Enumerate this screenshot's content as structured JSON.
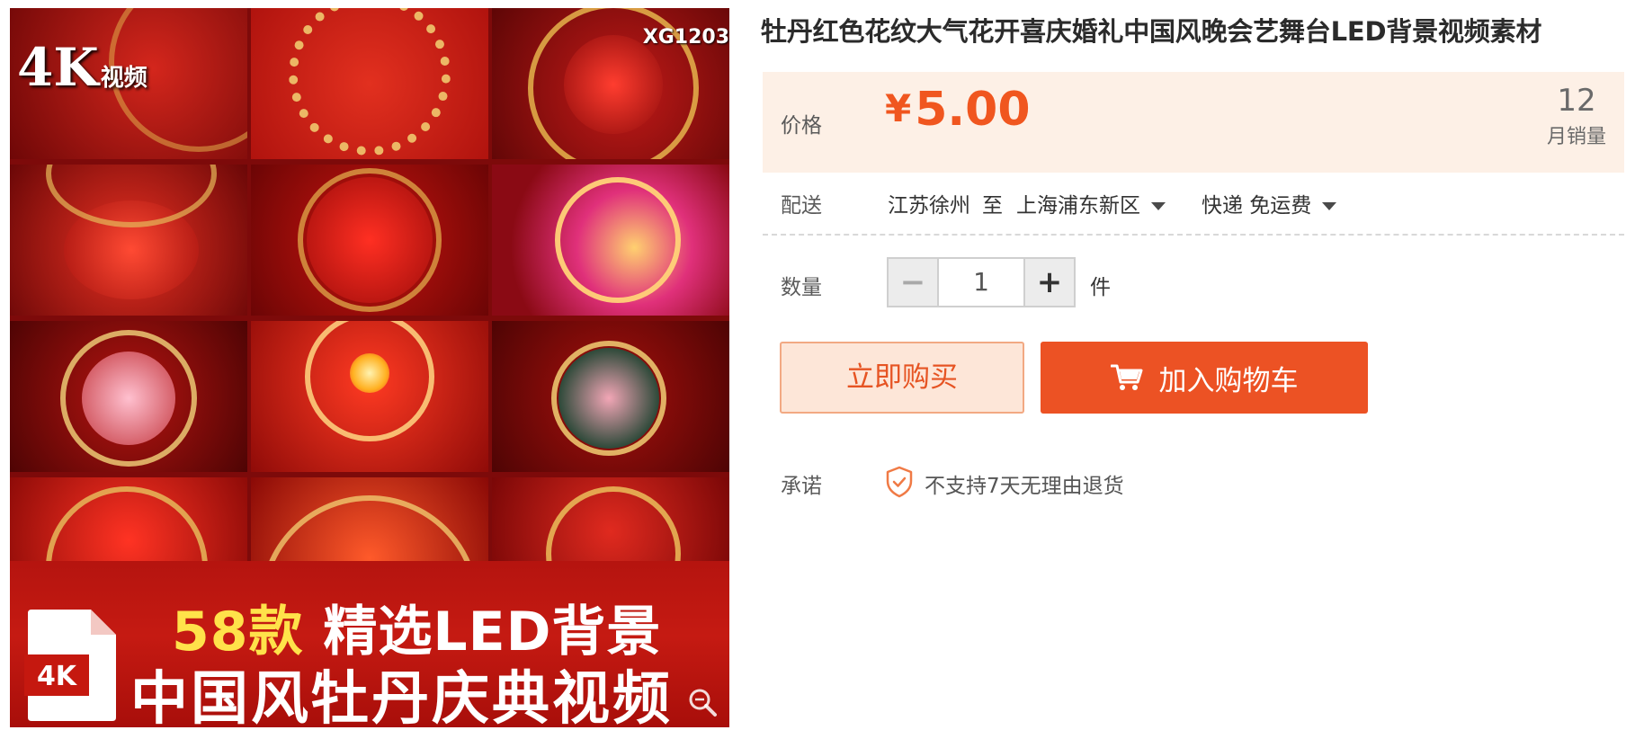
{
  "product_image": {
    "badge_big": "4K",
    "badge_small": "视频",
    "code": "XG1203",
    "banner_count": "58款",
    "banner_line1_rest": "精选LED背景",
    "banner_line2": "中国风牡丹庆典视频",
    "file_icon_label": "4K"
  },
  "title": "牡丹红色花纹大气花开喜庆婚礼中国风晚会艺舞台LED背景视频素材",
  "price": {
    "label": "价格",
    "currency": "¥",
    "value": "5.00",
    "sales_count": "12",
    "sales_label": "月销量"
  },
  "shipping": {
    "label": "配送",
    "from": "江苏徐州",
    "to_word": "至",
    "destination": "上海浦东新区",
    "method": "快递 免运费"
  },
  "quantity": {
    "label": "数量",
    "value": "1",
    "unit": "件",
    "minus": "−",
    "plus": "+"
  },
  "actions": {
    "buy_now": "立即购买",
    "add_to_cart": "加入购物车"
  },
  "promise": {
    "label": "承诺",
    "text": "不支持7天无理由退货"
  },
  "colors": {
    "accent": "#ec5224",
    "price": "#f0561f",
    "price_bg": "#fdf0e6"
  }
}
